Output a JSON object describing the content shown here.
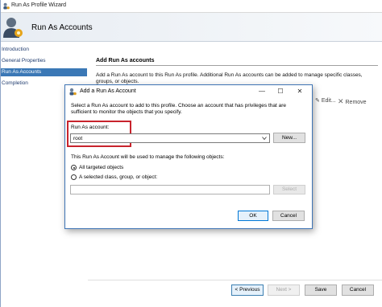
{
  "wizard": {
    "title": "Run As Profile Wizard",
    "banner_title": "Run As Accounts",
    "nav": [
      {
        "label": "Introduction"
      },
      {
        "label": "General Properties"
      },
      {
        "label": "Run As Accounts"
      },
      {
        "label": "Completion"
      }
    ],
    "active_nav": "Run As Accounts",
    "heading": "Add Run As accounts",
    "description": "Add a Run As account to this Run As profile.  Additional Run As accounts can be added to manage specific classes, groups, or objects.",
    "edit_label": "Edit...",
    "remove_label": "Remove",
    "buttons": {
      "previous": "< Previous",
      "next": "Next >",
      "save": "Save",
      "cancel": "Cancel"
    }
  },
  "dialog": {
    "title": "Add a Run As Account",
    "intro": "Select a Run As account to add to this profile.  Choose an account that has privileges that are sufficient to monitor the objects that you specify.",
    "account_label": "Run As account:",
    "account_value": "root",
    "new_button": "New...",
    "manage_label": "This Run As Account will be used to manage the following objects:",
    "radio_all": "All targeted objects",
    "radio_selected": "A selected class, group, or object:",
    "selected_radio": "All targeted objects",
    "object_value": "",
    "select_button": "Select",
    "ok_button": "OK",
    "cancel_button": "Cancel",
    "controls": {
      "minimize": "—",
      "maximize": "☐",
      "close": "✕"
    }
  },
  "colors": {
    "accent": "#3b78b6",
    "highlight_box": "#c8232c",
    "dialog_border": "#3e74b5"
  }
}
